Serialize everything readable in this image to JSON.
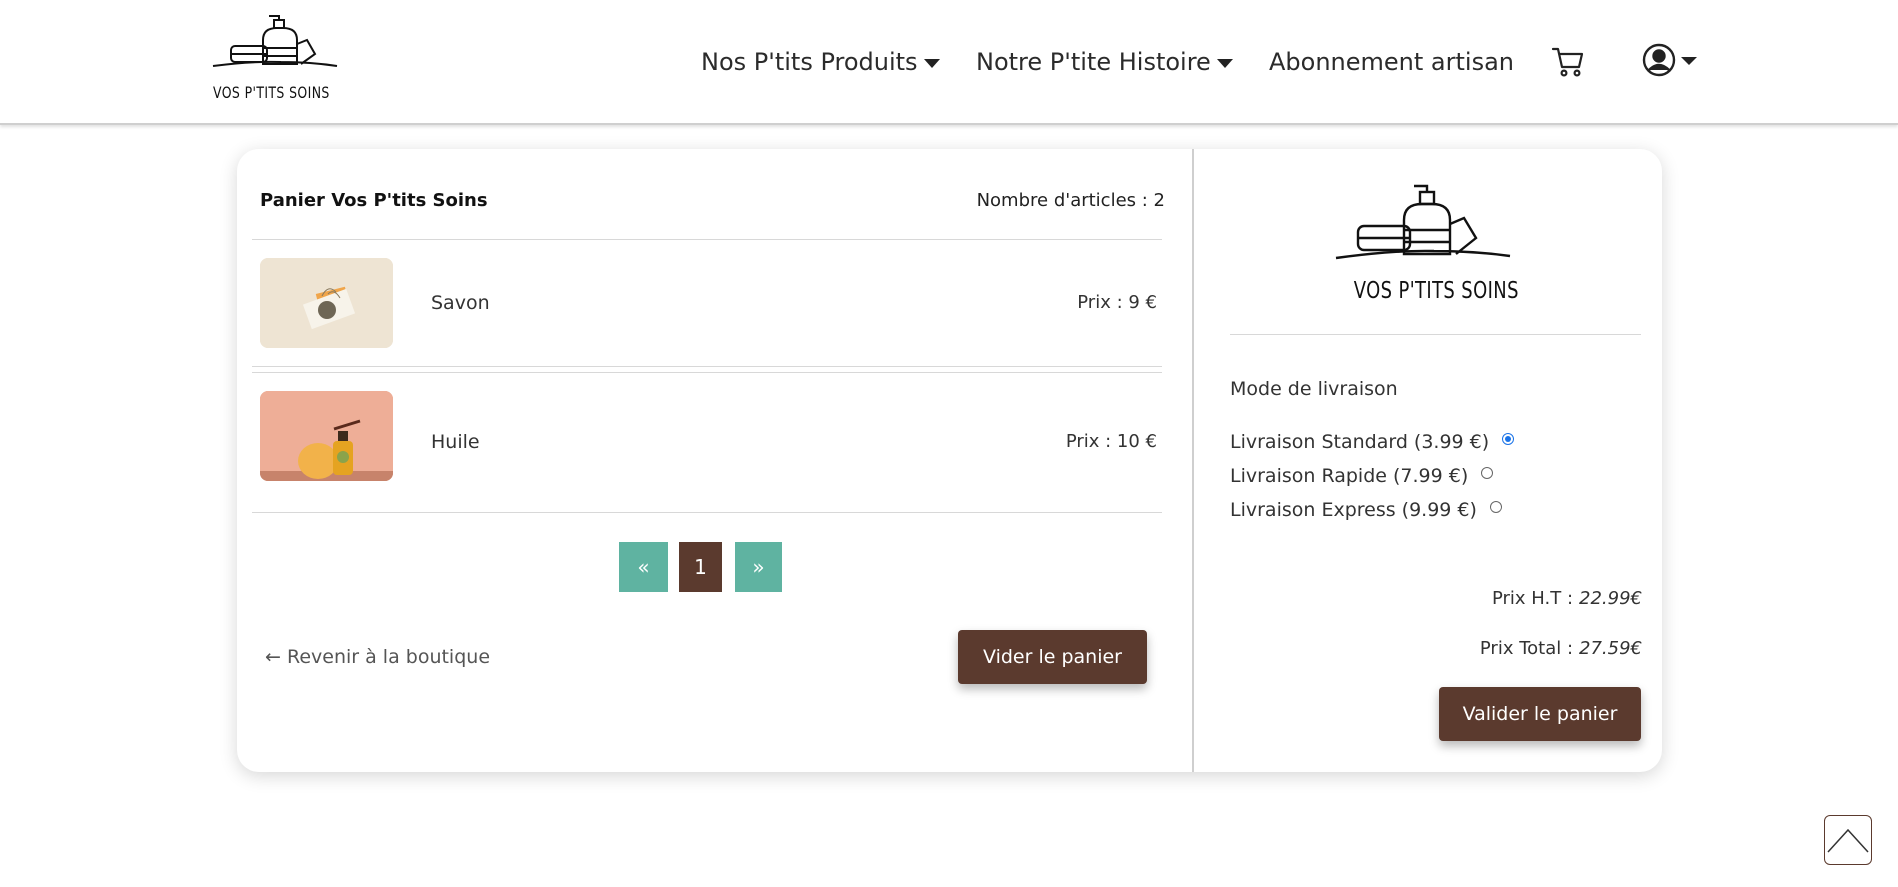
{
  "brand": {
    "name": "VOS P'TITS SOINS"
  },
  "nav": {
    "products": "Nos P'tits Produits",
    "story": "Notre P'tite Histoire",
    "subscription": "Abonnement artisan"
  },
  "cart": {
    "title": "Panier Vos P'tits Soins",
    "count_label": "Nombre d'articles : 2",
    "items": [
      {
        "name": "Savon",
        "price": "Prix : 9 €"
      },
      {
        "name": "Huile",
        "price": "Prix : 10 €"
      }
    ],
    "pagination": {
      "prev": "«",
      "current": "1",
      "next": "»"
    },
    "back_label": "Revenir à la boutique",
    "empty_label": "Vider le panier"
  },
  "summary": {
    "mode_title": "Mode de livraison",
    "options": [
      {
        "label": "Livraison Standard (3.99 €)",
        "selected": true
      },
      {
        "label": "Livraison Rapide (7.99 €)",
        "selected": false
      },
      {
        "label": "Livraison Express (9.99 €)",
        "selected": false
      }
    ],
    "ht_label": "Prix H.T :",
    "ht_value": "22.99€",
    "total_label": "Prix Total :",
    "total_value": "27.59€",
    "validate_label": "Valider le panier"
  },
  "colors": {
    "brown": "#5b3a2e",
    "teal": "#5fb3a1",
    "radio_blue": "#1a73e8"
  }
}
